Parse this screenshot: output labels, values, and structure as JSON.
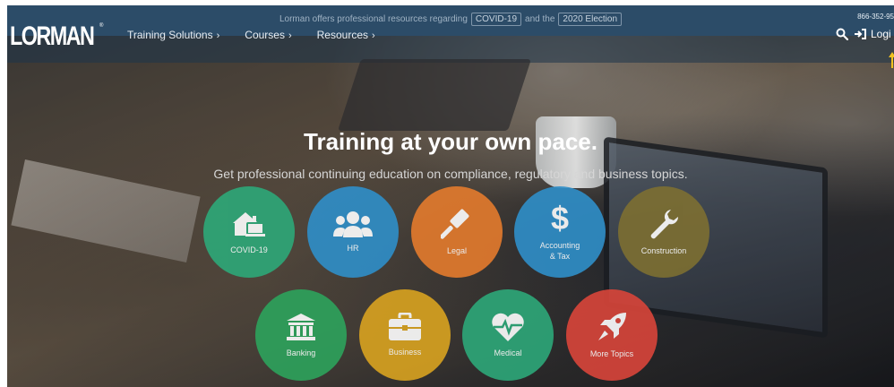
{
  "announcement": {
    "text_before": "Lorman offers professional resources regarding",
    "pill1": "COVID-19",
    "text_middle": "and the",
    "pill2": "2020 Election"
  },
  "phone": "866-352-95",
  "brand": {
    "logo": "LORMAN",
    "reg": "®"
  },
  "nav": {
    "items": [
      {
        "label": "Training Solutions"
      },
      {
        "label": "Courses"
      },
      {
        "label": "Resources"
      }
    ],
    "chevron": "›",
    "login_label": "Logi"
  },
  "hero": {
    "headline": "Training at your own pace.",
    "subhead": "Get professional continuing education on compliance, regulatory and business topics."
  },
  "topics": [
    {
      "label": "COVID-19",
      "icon": "home-laptop-icon",
      "color": "#2da879"
    },
    {
      "label": "HR",
      "icon": "people-icon",
      "color": "#2f8fc9"
    },
    {
      "label": "Legal",
      "icon": "gavel-icon",
      "color": "#e47b2d"
    },
    {
      "label": "Accounting\n& Tax",
      "icon": "dollar-icon",
      "color": "#2f8fc9"
    },
    {
      "label": "Construction",
      "icon": "wrench-icon",
      "color": "#7d6f32"
    },
    {
      "label": "Banking",
      "icon": "bank-icon",
      "color": "#2da35c"
    },
    {
      "label": "Business",
      "icon": "briefcase-icon",
      "color": "#d9a320"
    },
    {
      "label": "Medical",
      "icon": "heartbeat-icon",
      "color": "#2da879"
    },
    {
      "label": "More Topics",
      "icon": "rocket-icon",
      "color": "#d9453a"
    }
  ],
  "colors": {
    "topbar": "#2c4c68",
    "accent_arrow": "#f0c020"
  }
}
